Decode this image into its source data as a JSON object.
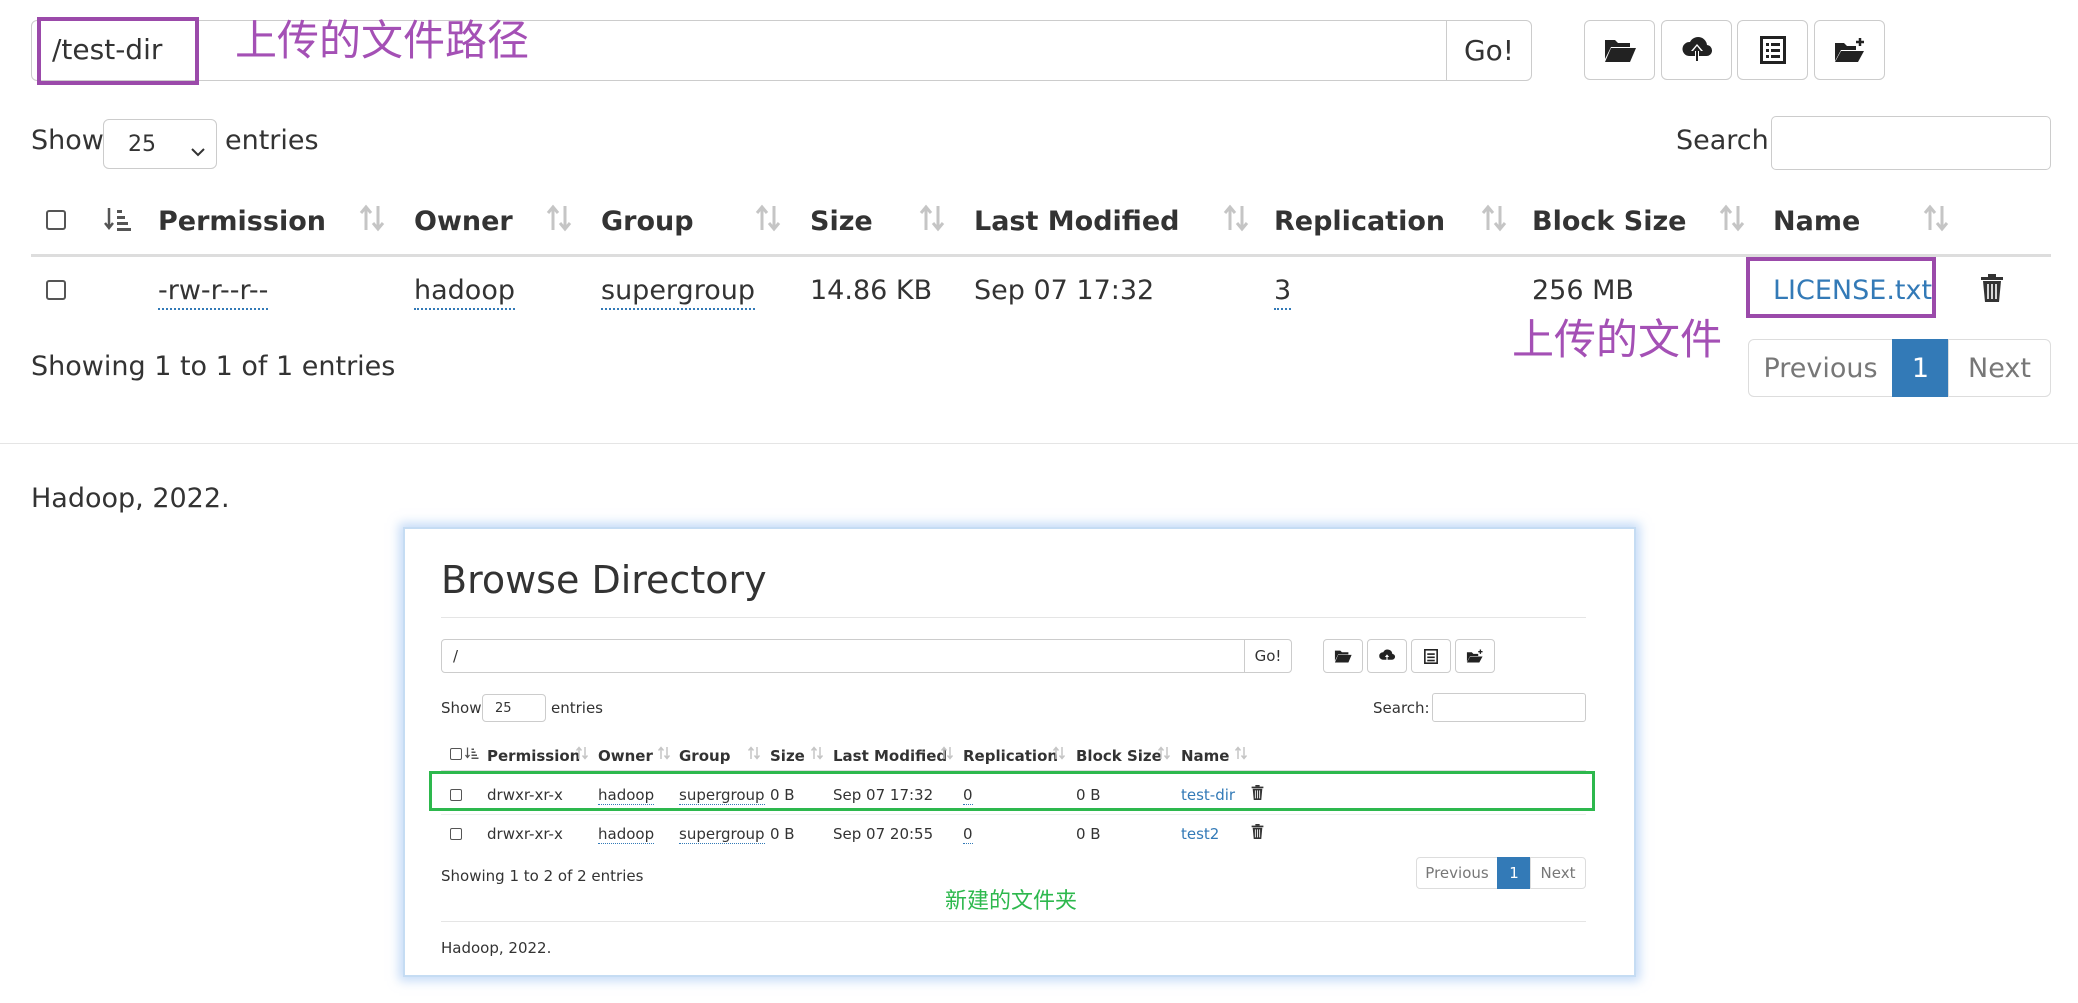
{
  "path_bar": {
    "value": "/test-dir",
    "go_label": "Go!"
  },
  "annotations": {
    "path_note": "上传的文件路径",
    "file_note": "上传的文件",
    "folder_note": "新建的文件夹"
  },
  "toolbar": {
    "icons": [
      "folder-open-icon",
      "cloud-upload-icon",
      "list-icon",
      "folder-new-icon"
    ]
  },
  "length": {
    "show_label": "Show",
    "selected": "25",
    "entries_label": "entries"
  },
  "search": {
    "label": "Search:",
    "value": ""
  },
  "table": {
    "columns": [
      "Permission",
      "Owner",
      "Group",
      "Size",
      "Last Modified",
      "Replication",
      "Block Size",
      "Name"
    ],
    "rows": [
      {
        "permission": "-rw-r--r--",
        "owner": "hadoop",
        "group": "supergroup",
        "size": "14.86 KB",
        "modified": "Sep 07 17:32",
        "replication": "3",
        "block_size": "256 MB",
        "name": "LICENSE.txt"
      }
    ]
  },
  "info": "Showing 1 to 1 of 1 entries",
  "pagination": {
    "previous": "Previous",
    "current": "1",
    "next": "Next"
  },
  "footer": "Hadoop, 2022.",
  "inset": {
    "heading": "Browse Directory",
    "path_value": "/",
    "go_label": "Go!",
    "show_label": "Show",
    "selected": "25",
    "entries_label": "entries",
    "search_label": "Search:",
    "columns": [
      "Permission",
      "Owner",
      "Group",
      "Size",
      "Last Modified",
      "Replication",
      "Block Size",
      "Name"
    ],
    "rows": [
      {
        "permission": "drwxr-xr-x",
        "owner": "hadoop",
        "group": "supergroup",
        "size": "0 B",
        "modified": "Sep 07 17:32",
        "replication": "0",
        "block_size": "0 B",
        "name": "test-dir"
      },
      {
        "permission": "drwxr-xr-x",
        "owner": "hadoop",
        "group": "supergroup",
        "size": "0 B",
        "modified": "Sep 07 20:55",
        "replication": "0",
        "block_size": "0 B",
        "name": "test2"
      }
    ],
    "info": "Showing 1 to 2 of 2 entries",
    "pagination": {
      "previous": "Previous",
      "current": "1",
      "next": "Next"
    },
    "footer": "Hadoop, 2022."
  },
  "colors": {
    "link": "#337ab7",
    "annotation_purple": "#a450b5",
    "annotation_green": "#2db84d"
  }
}
